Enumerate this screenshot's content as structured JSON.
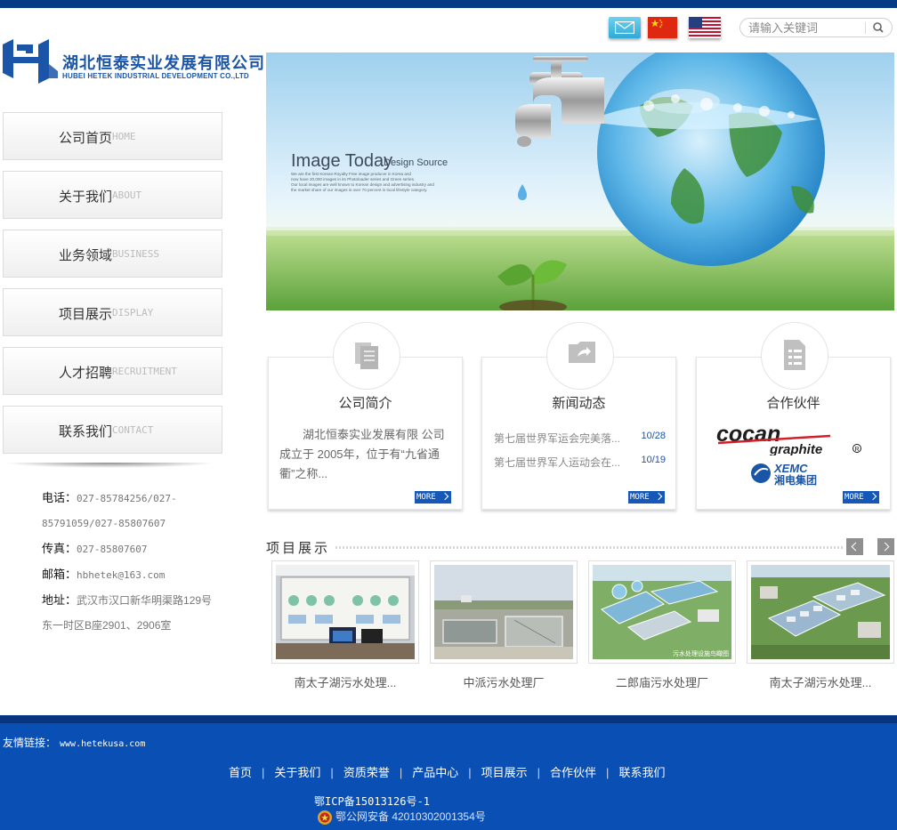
{
  "search": {
    "placeholder": "请输入关键词"
  },
  "logo": {
    "cn": "湖北恒泰实业发展有限公司",
    "en": "HUBEI HETEK INDUSTRIAL DEVELOPMENT CO.,LTD"
  },
  "nav": [
    {
      "cn": "公司首页",
      "en": "HOME"
    },
    {
      "cn": "关于我们",
      "en": "ABOUT"
    },
    {
      "cn": "业务领域",
      "en": "BUSINESS"
    },
    {
      "cn": "项目展示",
      "en": "DISPLAY"
    },
    {
      "cn": "人才招聘",
      "en": "RECRUITMENT"
    },
    {
      "cn": "联系我们",
      "en": "CONTACT"
    }
  ],
  "contact": {
    "phone_label": "电话：",
    "phone_1": "027-85784256/027-",
    "phone_2": "85791059/027-85807607",
    "fax_label": "传真：",
    "fax": "027-85807607",
    "email_label": "邮箱：",
    "email": "hbhetek@163.com",
    "address_label": "地址：",
    "address_1": "武汉市汉口新华明渠路129号",
    "address_2": "东一时区B座2901、2906室"
  },
  "banner": {
    "title": "Image Today",
    "subtitle": "Design Source",
    "lines": [
      "We are the first Korean Royalty Free image producer in Korea and",
      "now have 20,000 images in its Photoloader series and Green series.",
      "Our local images are well known to Korean design and advertising industry and",
      "the market share of our images is over 70 percent in local lifestyle category."
    ]
  },
  "boxes": {
    "intro": {
      "title": "公司简介",
      "text": "湖北恒泰实业发展有限 公司成立于 2005年，位于有“九省通衢”之称...",
      "more": "MORE"
    },
    "news": {
      "title": "新闻动态",
      "items": [
        {
          "text": "第七届世界军运会完美落...",
          "date": "10/28"
        },
        {
          "text": "第七届世界军人运动会在...",
          "date": "10/19"
        }
      ],
      "more": "MORE"
    },
    "partners": {
      "title": "合作伙伴",
      "logo1_main": "cocan",
      "logo1_sub": "graphite",
      "logo2_en": "XEMC",
      "logo2_cn": "湘电集团",
      "more": "MORE"
    }
  },
  "projects": {
    "title": "项目展示",
    "items": [
      {
        "caption": "南太子湖污水处理..."
      },
      {
        "caption": "中派污水处理厂"
      },
      {
        "caption": "二郎庙污水处理厂"
      },
      {
        "caption": "南太子湖污水处理..."
      }
    ],
    "image3_label": "污水处理设施鸟瞰图"
  },
  "footer": {
    "friend_label": "友情链接：",
    "friend_url": "www.hetekusa.com",
    "links": [
      "首页",
      "关于我们",
      "资质荣誉",
      "产品中心",
      "项目展示",
      "合作伙伴",
      "联系我们"
    ],
    "separator": "|",
    "icp": "鄂ICP备15013126号-1",
    "police": "鄂公网安备 42010302001354号"
  },
  "colors": {
    "brand": "#1b55a8",
    "footer": "#0a4fb4",
    "topbar": "#073a86",
    "more_button": "#1558b8"
  }
}
